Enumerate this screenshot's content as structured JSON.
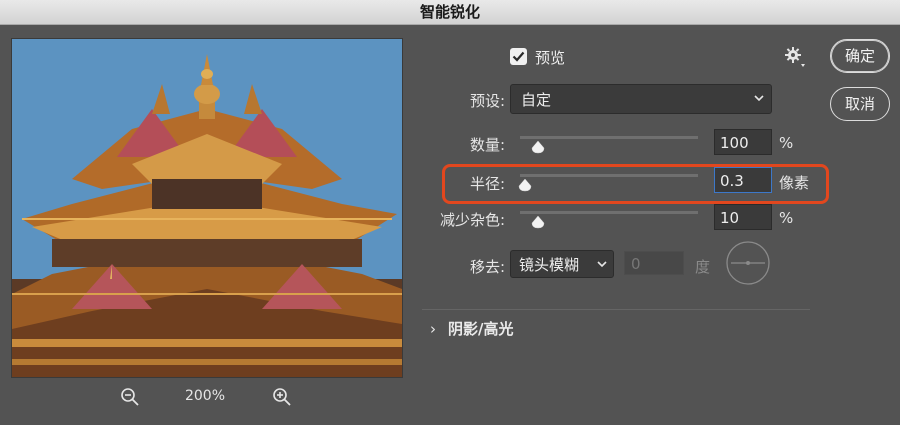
{
  "dialog": {
    "title": "智能锐化"
  },
  "preview_panel": {
    "zoom_level": "200%",
    "icons": {
      "zoom_out": "zoom-out-icon",
      "zoom_in": "zoom-in-icon"
    }
  },
  "controls": {
    "preview": {
      "label": "预览",
      "checked": true
    },
    "settings_icon": "gear-icon",
    "preset": {
      "label": "预设:",
      "value": "自定"
    },
    "amount": {
      "label": "数量:",
      "value": "100",
      "unit": "%",
      "level_percent": 10
    },
    "radius": {
      "label": "半径:",
      "value": "0.3",
      "unit": "像素",
      "level_percent": 3
    },
    "reduce_noise": {
      "label": "减少杂色:",
      "value": "10",
      "unit": "%",
      "level_percent": 10
    },
    "remove": {
      "label": "移去:",
      "value": "镜头模糊",
      "angle_value": "0",
      "angle_unit": "度"
    }
  },
  "buttons": {
    "ok": "确定",
    "cancel": "取消"
  },
  "sections": {
    "shadow_highlight": "阴影/高光"
  },
  "colors": {
    "highlight_border": "#e2471e",
    "background": "#535353",
    "active_field_border": "#3d78c9"
  }
}
